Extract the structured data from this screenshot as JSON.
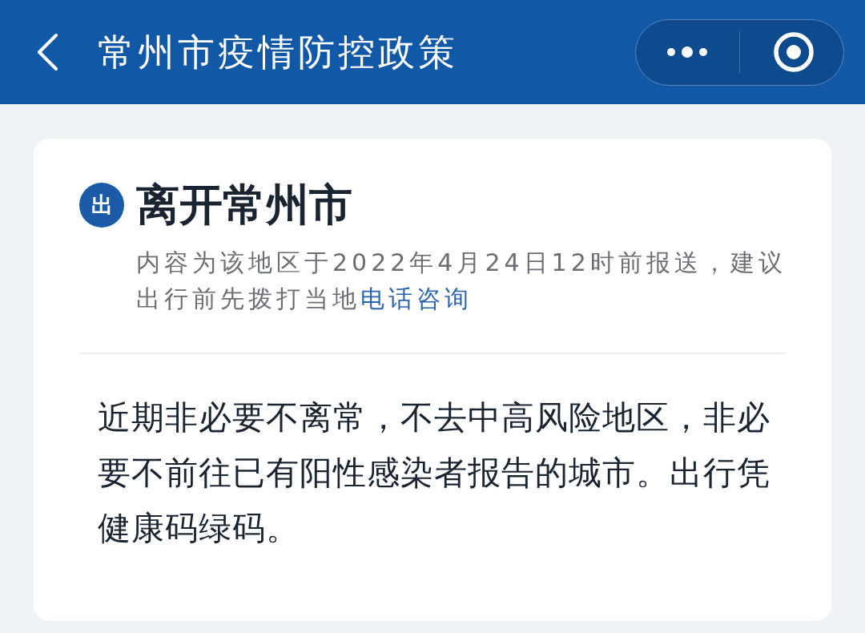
{
  "header": {
    "title": "常州市疫情防控政策"
  },
  "card": {
    "badge": "出",
    "title": "离开常州市",
    "note": {
      "text": "内容为该地区于2022年4月24日12时前报送，建议出行前先拨打当地",
      "link": "电话咨询"
    },
    "body": "近期非必要不离常，不去中高风险地区，非必要不前往已有阳性感染者报告的城市。出行凭健康码绿码。"
  }
}
